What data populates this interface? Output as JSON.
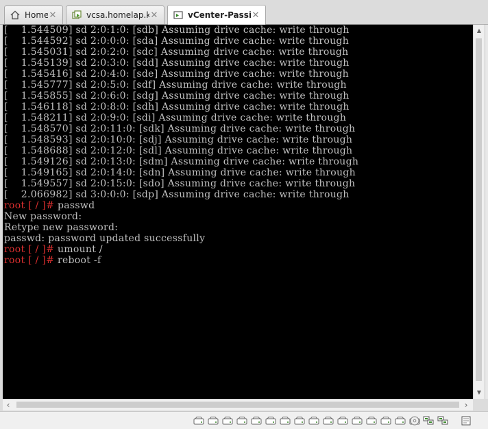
{
  "tabs": [
    {
      "label": "Home",
      "icon": "home-icon"
    },
    {
      "label": "vcsa.homelap.kr",
      "icon": "vm-powered-on-icon"
    },
    {
      "label": "vCenter-Passive",
      "icon": "vm-console-icon",
      "active": true
    }
  ],
  "console": {
    "lines": [
      {
        "text": "[    1.544509] sd 2:0:1:0: [sdb] Assuming drive cache: write through"
      },
      {
        "text": "[    1.544592] sd 2:0:0:0: [sda] Assuming drive cache: write through"
      },
      {
        "text": "[    1.545031] sd 2:0:2:0: [sdc] Assuming drive cache: write through"
      },
      {
        "text": "[    1.545139] sd 2:0:3:0: [sdd] Assuming drive cache: write through"
      },
      {
        "text": "[    1.545416] sd 2:0:4:0: [sde] Assuming drive cache: write through"
      },
      {
        "text": "[    1.545777] sd 2:0:5:0: [sdf] Assuming drive cache: write through"
      },
      {
        "text": "[    1.545855] sd 2:0:6:0: [sdg] Assuming drive cache: write through"
      },
      {
        "text": "[    1.546118] sd 2:0:8:0: [sdh] Assuming drive cache: write through"
      },
      {
        "text": "[    1.548211] sd 2:0:9:0: [sdi] Assuming drive cache: write through"
      },
      {
        "text": "[    1.548570] sd 2:0:11:0: [sdk] Assuming drive cache: write through"
      },
      {
        "text": "[    1.548593] sd 2:0:10:0: [sdj] Assuming drive cache: write through"
      },
      {
        "text": "[    1.548688] sd 2:0:12:0: [sdl] Assuming drive cache: write through"
      },
      {
        "text": "[    1.549126] sd 2:0:13:0: [sdm] Assuming drive cache: write through"
      },
      {
        "text": "[    1.549165] sd 2:0:14:0: [sdn] Assuming drive cache: write through"
      },
      {
        "text": "[    1.549557] sd 2:0:15:0: [sdo] Assuming drive cache: write through"
      },
      {
        "text": "[    2.066982] sd 3:0:0:0: [sdp] Assuming drive cache: write through"
      },
      {
        "prompt": "root [ / ]# ",
        "text": "passwd"
      },
      {
        "text": "New password:"
      },
      {
        "text": "Retype new password:"
      },
      {
        "text": "passwd: password updated successfully"
      },
      {
        "prompt": "root [ / ]# ",
        "text": "umount /"
      },
      {
        "prompt": "root [ / ]# ",
        "text": "reboot -f"
      }
    ]
  },
  "status_bar": {
    "devices": [
      "hard-disk-icon",
      "hard-disk-icon",
      "hard-disk-icon",
      "hard-disk-icon",
      "hard-disk-icon",
      "hard-disk-icon",
      "hard-disk-icon",
      "hard-disk-icon",
      "hard-disk-icon",
      "hard-disk-icon",
      "hard-disk-icon",
      "hard-disk-icon",
      "hard-disk-icon",
      "hard-disk-icon",
      "hard-disk-icon",
      "hard-disk-icon",
      "cd-rom-icon",
      "network-adapter-icon",
      "network-adapter-icon",
      "notes-icon"
    ]
  },
  "colors": {
    "prompt": "#e03030",
    "console_text": "#c0c0c0",
    "console_bg": "#000000"
  }
}
